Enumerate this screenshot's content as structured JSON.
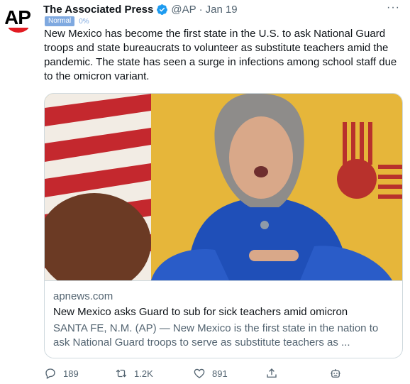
{
  "tweet": {
    "author_name": "The Associated Press",
    "handle": "@AP",
    "separator": "·",
    "date": "Jan 19",
    "more_icon": "more-icon",
    "avatar_logo": "AP",
    "badge_label": "Normal",
    "badge_percent": "0%",
    "text": "New Mexico has become the first state in the U.S. to ask National Guard troops and state bureaucrats to volunteer as substitute teachers amid the pandemic. The state has seen a surge in infections among school staff due to the omicron variant."
  },
  "card": {
    "domain": "apnews.com",
    "title": "New Mexico asks Guard to sub for sick teachers amid omicron",
    "description": "SANTA FE, N.M. (AP) — New Mexico is the first state in the nation to ask National Guard troops to serve as substitute teachers as ..."
  },
  "actions": {
    "reply_count": "189",
    "retweet_count": "1.2K",
    "like_count": "891"
  },
  "colors": {
    "verified": "#1d9bf0",
    "muted_text": "#536471",
    "badge": "#7fa9e0",
    "ap_red": "#e21b22"
  }
}
